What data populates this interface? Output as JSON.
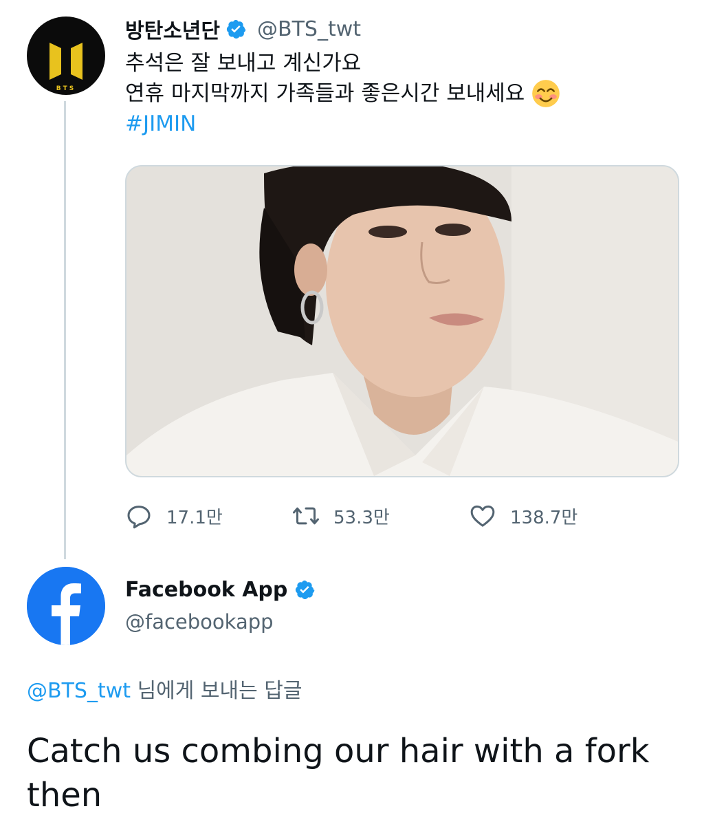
{
  "tweet": {
    "author_name": "방탄소년단",
    "author_handle": "@BTS_twt",
    "avatar_text": "BTS",
    "text_lines": [
      "추석은 잘 보내고 계신가요",
      "연휴 마지막까지 가족들과 좋은시간 보내세요"
    ],
    "hashtag": "#JIMIN",
    "emoji": "smiling-face-with-smiling-eyes",
    "stats": {
      "replies": "17.1만",
      "retweets": "53.3만",
      "likes": "138.7만"
    }
  },
  "reply": {
    "author_name": "Facebook App",
    "author_handle": "@facebookapp",
    "reply_to_handle": "@BTS_twt",
    "reply_to_suffix": "님에게 보내는 답글",
    "text": "Catch us combing our hair with a fork then"
  },
  "colors": {
    "accent": "#1d9bf0",
    "verified": "#1d9bf0",
    "facebook_blue": "#1877f2",
    "bts_gold": "#e8c21e",
    "muted_text": "#536471",
    "border": "#cfd9de"
  },
  "icons": {
    "reply": "reply-icon",
    "retweet": "retweet-icon",
    "like": "heart-icon",
    "verified": "verified-badge-icon"
  }
}
